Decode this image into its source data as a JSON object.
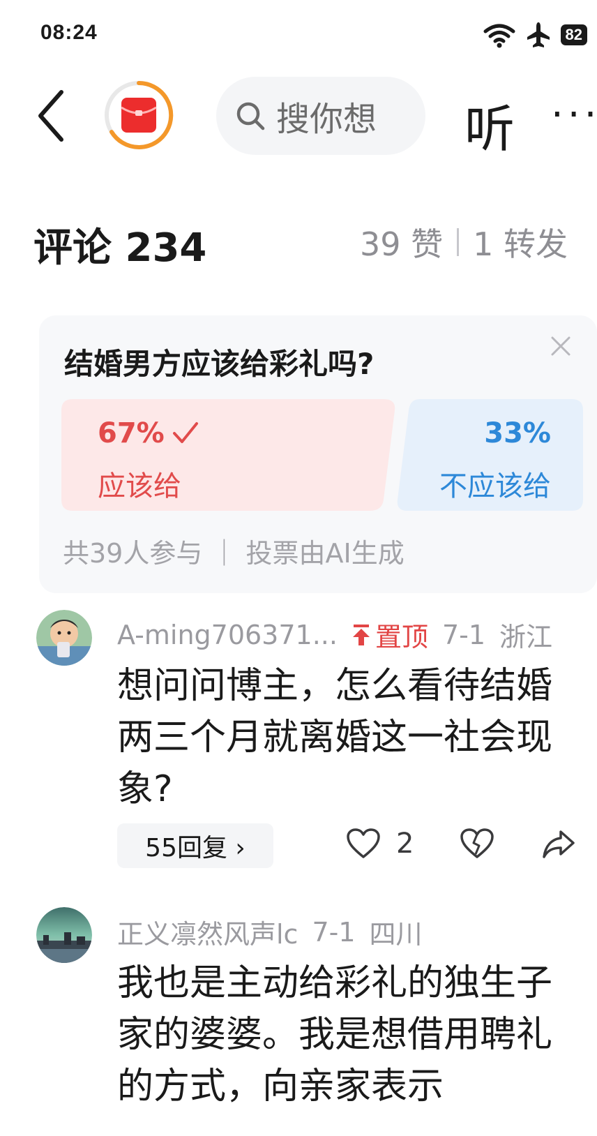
{
  "status_bar": {
    "time": "08:24",
    "battery": "82",
    "icons": [
      "wifi-icon",
      "airplane-icon",
      "battery-icon"
    ]
  },
  "header": {
    "search_placeholder": "搜你想",
    "listen_label": "听",
    "more_label": "···"
  },
  "comments_header": {
    "title": "评论 234",
    "likes": "39 赞",
    "reposts": "1 转发"
  },
  "poll": {
    "question": "结婚男方应该给彩礼吗?",
    "option_a": {
      "percent": "67%",
      "label": "应该给",
      "percent_value": 67
    },
    "option_b": {
      "percent": "33%",
      "label": "不应该给",
      "percent_value": 33
    },
    "footer": "共39人参与 ｜ 投票由AI生成",
    "colors": {
      "yes": "#e14b4b",
      "no": "#2d88d8",
      "yes_bg": "#fde8e8",
      "no_bg": "#e6f0fb"
    }
  },
  "comments": [
    {
      "username": "A-ming706371...",
      "pinned_label": "置顶",
      "date": "7-1",
      "location": "浙江",
      "text": "想问问博主，怎么看待结婚两三个月就离婚这一社会现象?",
      "replies_label": "55回复 ›",
      "like_count": "2"
    },
    {
      "username": "正义凛然风声lc",
      "date": "7-1",
      "location": "四川",
      "text": "我也是主动给彩礼的独生子家的婆婆。我是想借用聘礼的方式，向亲家表示"
    }
  ]
}
